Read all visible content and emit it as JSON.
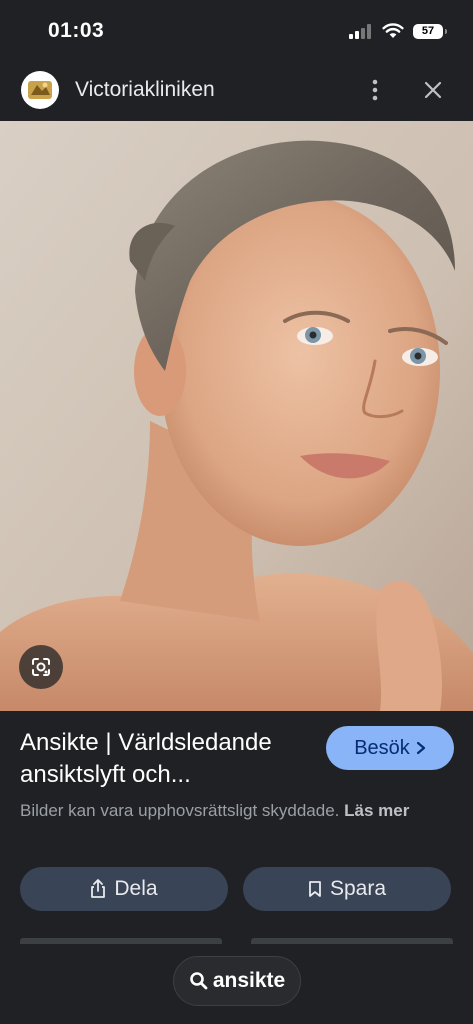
{
  "status_bar": {
    "time": "01:03",
    "battery": "57"
  },
  "header": {
    "site_name": "Victoriakliniken",
    "logo_icon": "site-favicon",
    "more_icon": "more-vert-icon",
    "close_icon": "close-icon"
  },
  "image": {
    "lens_icon": "google-lens-icon"
  },
  "result": {
    "title": "Ansikte | Världsledande ansiktslyft och...",
    "visit_label": "Besök",
    "copyright_text": "Bilder kan vara upphovsrättsligt skyddade.",
    "read_more": "Läs mer"
  },
  "actions": {
    "share_label": "Dela",
    "save_label": "Spara"
  },
  "search_chip": {
    "query": "ansikte"
  },
  "colors": {
    "background": "#202124",
    "accent": "#8ab4f8",
    "button_bg": "#394457"
  }
}
